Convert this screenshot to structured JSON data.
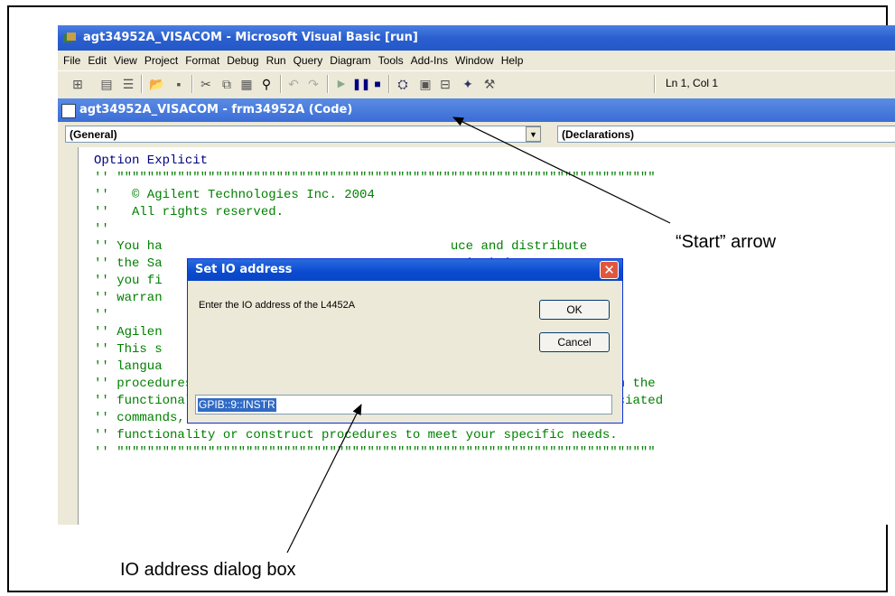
{
  "main_window": {
    "title": "agt34952A_VISACOM - Microsoft Visual Basic [run]",
    "menu": [
      "File",
      "Edit",
      "View",
      "Project",
      "Format",
      "Debug",
      "Run",
      "Query",
      "Diagram",
      "Tools",
      "Add-Ins",
      "Window",
      "Help"
    ],
    "cursor_position": "Ln 1, Col 1"
  },
  "code_window": {
    "title": "agt34952A_VISACOM - frm34952A (Code)",
    "object_combo": "(General)",
    "proc_combo": "(Declarations)",
    "lines": [
      "Option Explicit",
      "'' \"\"\"\"\"\"\"\"\"\"\"\"\"\"\"\"\"\"\"\"\"\"\"\"\"\"\"\"\"\"\"\"\"\"\"\"\"\"\"\"\"\"\"\"\"\"\"\"\"\"\"\"\"\"\"\"\"\"\"\"\"\"\"\"\"\"\"\"\"\"\"",
      "''   © Agilent Technologies Inc. 2004",
      "''   All rights reserved.",
      "''",
      "'' You ha                                      uce and distribute",
      "'' the Sa                                      rsion) in any way",
      "'' you fi                                      t Technologies has no",
      "'' warran                                      plication Files.",
      "''",
      "'' Agilen                                      or illustration only,",
      "'' This s                                      th the programming",
      "'' langua                                      eate and debug",
      "'' procedures. Agilent Technologies support engineers can help explain the",
      "'' functionality of Agilent Technologies software components and associated",
      "'' commands, but they will not modify these samples to provide added",
      "'' functionality or construct procedures to meet your specific needs.",
      "'' \"\"\"\"\"\"\"\"\"\"\"\"\"\"\"\"\"\"\"\"\"\"\"\"\"\"\"\"\"\"\"\"\"\"\"\"\"\"\"\"\"\"\"\"\"\"\"\"\"\"\"\"\"\"\"\"\"\"\"\"\"\"\"\"\"\"\"\"\"\"\""
    ]
  },
  "dialog": {
    "title": "Set IO address",
    "prompt": "Enter the IO address of the L4452A",
    "ok_label": "OK",
    "cancel_label": "Cancel",
    "input_value": "GPIB::9::INSTR"
  },
  "annotations": {
    "start_arrow": "“Start” arrow",
    "dialog_label": "IO address dialog box"
  }
}
